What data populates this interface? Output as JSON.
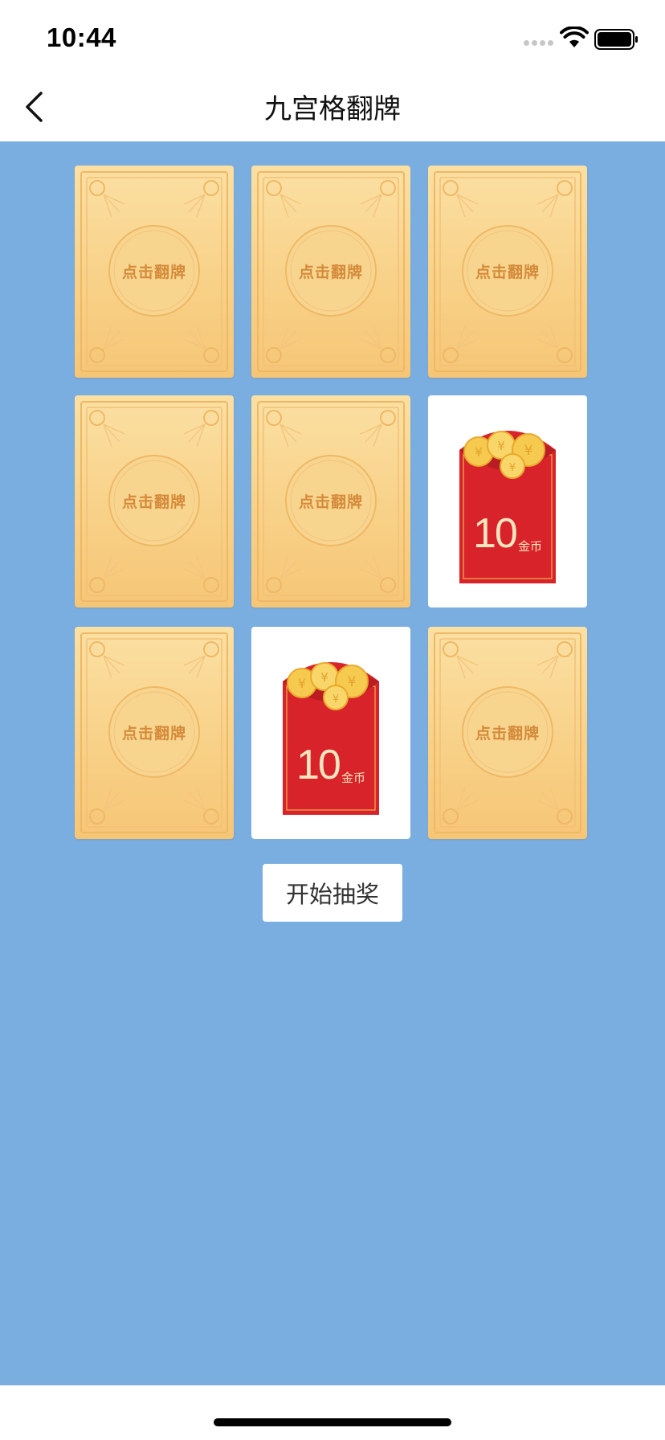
{
  "status_bar": {
    "time": "10:44",
    "icons": [
      "signal-dots",
      "wifi-icon",
      "battery-icon"
    ]
  },
  "nav": {
    "title": "九宫格翻牌",
    "back_icon": "chevron-left-icon"
  },
  "colors": {
    "page_background": "#7aaee1",
    "card_back": "#f8d188",
    "card_label": "#d48a3a",
    "envelope_red": "#d8232a",
    "coin_gold": "#f6c94f"
  },
  "cards": [
    {
      "state": "back",
      "label": "点击翻牌"
    },
    {
      "state": "back",
      "label": "点击翻牌"
    },
    {
      "state": "back",
      "label": "点击翻牌"
    },
    {
      "state": "back",
      "label": "点击翻牌"
    },
    {
      "state": "back",
      "label": "点击翻牌"
    },
    {
      "state": "revealed",
      "amount": "10",
      "unit": "金币"
    },
    {
      "state": "back",
      "label": "点击翻牌"
    },
    {
      "state": "revealed",
      "amount": "10",
      "unit": "金币"
    },
    {
      "state": "back",
      "label": "点击翻牌"
    }
  ],
  "start_button": {
    "label": "开始抽奖"
  }
}
